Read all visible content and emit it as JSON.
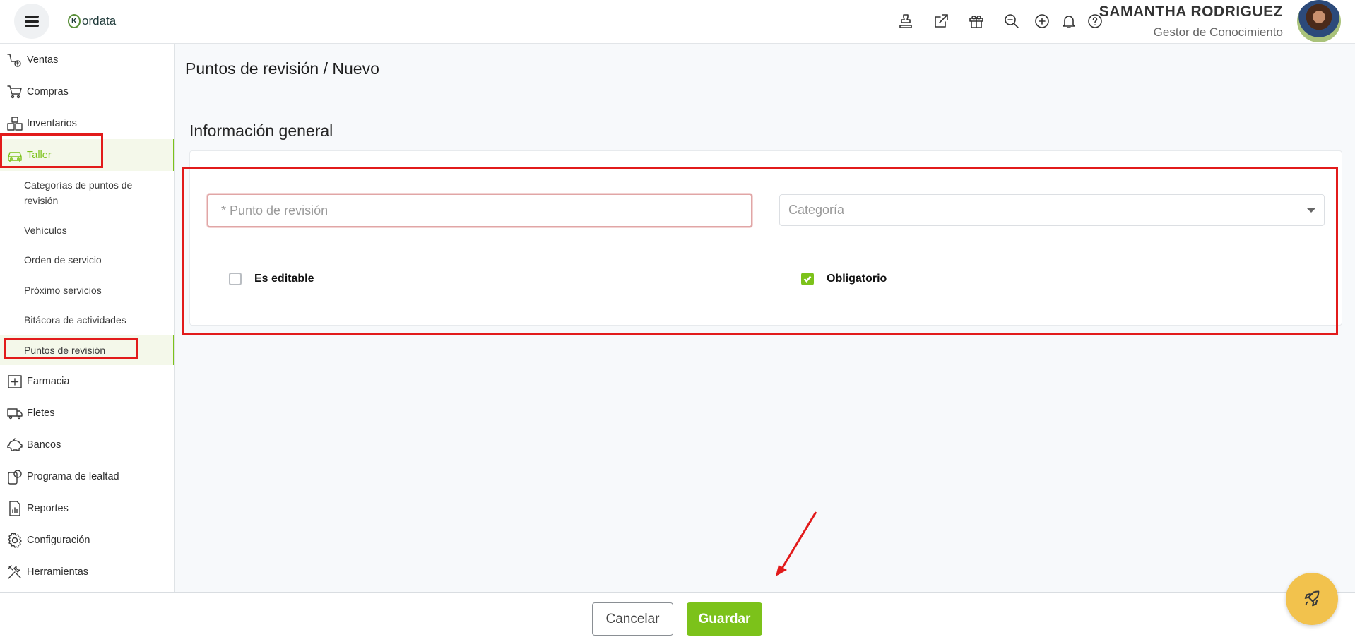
{
  "header": {
    "logo_text": "ordata",
    "logo_mark": "K",
    "user_name": "SAMANTHA RODRIGUEZ",
    "user_role": "Gestor de Conocimiento",
    "icons": [
      "stamp-icon",
      "external-link-icon",
      "gift-icon",
      "search-zoom-icon",
      "add-circle-icon",
      "bell-icon",
      "help-icon"
    ]
  },
  "sidebar": {
    "items": [
      {
        "label": "Ventas",
        "icon": "sales-icon"
      },
      {
        "label": "Compras",
        "icon": "cart-icon"
      },
      {
        "label": "Inventarios",
        "icon": "boxes-icon"
      },
      {
        "label": "Taller",
        "icon": "car-icon"
      }
    ],
    "sub_items": [
      {
        "label": "Categorías de puntos de revisión"
      },
      {
        "label": "Vehículos"
      },
      {
        "label": "Orden de servicio"
      },
      {
        "label": "Próximo servicios"
      },
      {
        "label": "Bitácora de actividades"
      },
      {
        "label": "Puntos de revisión"
      }
    ],
    "items_after": [
      {
        "label": "Farmacia",
        "icon": "pharmacy-icon"
      },
      {
        "label": "Fletes",
        "icon": "truck-icon"
      },
      {
        "label": "Bancos",
        "icon": "piggy-bank-icon"
      },
      {
        "label": "Programa de lealtad",
        "icon": "loyalty-icon"
      },
      {
        "label": "Reportes",
        "icon": "report-icon"
      },
      {
        "label": "Configuración",
        "icon": "gear-icon"
      },
      {
        "label": "Herramientas",
        "icon": "tools-icon"
      }
    ]
  },
  "main": {
    "breadcrumb": "Puntos de revisión /  Nuevo",
    "section_title": "Información general",
    "form": {
      "punto_placeholder": "* Punto de revisión",
      "punto_value": "",
      "categoria_placeholder": "Categoría",
      "es_editable_label": "Es editable",
      "es_editable_checked": false,
      "obligatorio_label": "Obligatorio",
      "obligatorio_checked": true
    }
  },
  "footer": {
    "cancel_label": "Cancelar",
    "save_label": "Guardar"
  },
  "colors": {
    "accent": "#7cc21a",
    "annotation": "#e21b1b",
    "rocket_button": "#f2c24d"
  }
}
